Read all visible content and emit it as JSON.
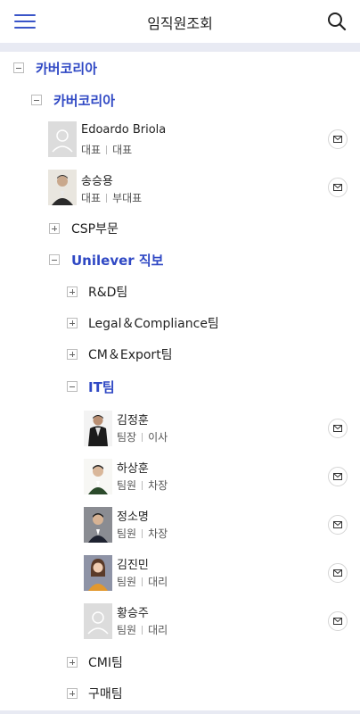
{
  "header": {
    "title": "임직원조회",
    "menu_icon": "hamburger-menu-icon",
    "search_icon": "search-icon"
  },
  "colors": {
    "accent": "#2f48c4",
    "band": "#e8eaf3"
  },
  "tree": {
    "root": {
      "label": "카버코리아",
      "expanded": true
    },
    "company": {
      "label": "카버코리아",
      "expanded": true
    },
    "executives": [
      {
        "name": "Edoardo Briola",
        "title": "대표",
        "position": "대표",
        "photo": "placeholder"
      },
      {
        "name": "송승용",
        "title": "대표",
        "position": "부대표",
        "photo": "photo"
      }
    ],
    "csp": {
      "label": "CSP부문",
      "expanded": false
    },
    "unilever": {
      "label": "Unilever 직보",
      "expanded": true
    },
    "teams": [
      {
        "label": "R&D팀",
        "expanded": false
      },
      {
        "label": "Legal＆Compliance팀",
        "expanded": false
      },
      {
        "label": "CM＆Export팀",
        "expanded": false
      }
    ],
    "it_team": {
      "label": "IT팀",
      "expanded": true
    },
    "it_members": [
      {
        "name": "김정훈",
        "title": "팀장",
        "position": "이사",
        "photo": "photo"
      },
      {
        "name": "하상훈",
        "title": "팀원",
        "position": "차장",
        "photo": "photo"
      },
      {
        "name": "정소명",
        "title": "팀원",
        "position": "차장",
        "photo": "photo"
      },
      {
        "name": "김진민",
        "title": "팀원",
        "position": "대리",
        "photo": "photo"
      },
      {
        "name": "황승주",
        "title": "팀원",
        "position": "대리",
        "photo": "placeholder"
      }
    ],
    "other_teams": [
      {
        "label": "CMI팀",
        "expanded": false
      },
      {
        "label": "구매팀",
        "expanded": false
      }
    ]
  }
}
